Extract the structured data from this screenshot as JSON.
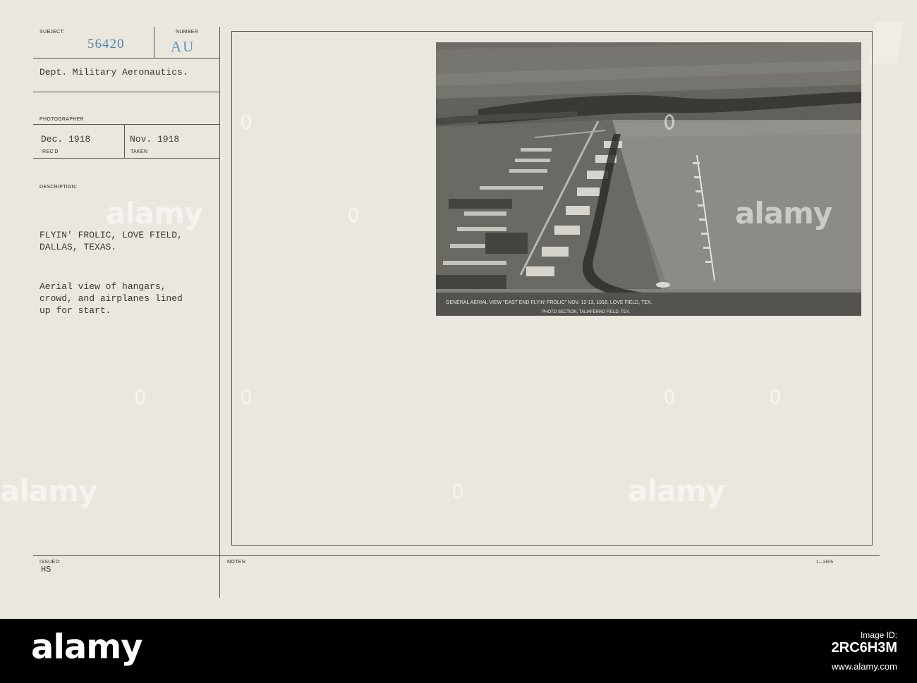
{
  "card": {
    "subject_label": "SUBJECT:",
    "subject_number": "56420",
    "number_label": "NUMBER",
    "number_value": "AU",
    "department": "Dept. Military Aeronautics.",
    "photographer_label": "PHOTOGRAPHER",
    "received_date": "Dec. 1918",
    "received_label": "REC'D",
    "taken_date": "Nov. 1918",
    "taken_label": "TAKEN",
    "description_label": "DESCRIPTION:",
    "title_line1": "FLYIN' FROLIC, LOVE FIELD,",
    "title_line2": "DALLAS, TEXAS.",
    "desc_line1": "Aerial view of hangars,",
    "desc_line2": "crowd, and airplanes lined",
    "desc_line3": "up for start.",
    "issued_label": "ISSUED:",
    "issued_value": "HS",
    "notes_label": "NOTES:",
    "form_number": "1—3605"
  },
  "photo": {
    "caption_line1": "GENERAL AERIAL VIEW \"EAST END FLYIN' FROLIC\" NOV. 12-13, 1918, LOVE FIELD, TEX.",
    "caption_line2": "PHOTO SECTION, TALIAFERRO FIELD, TEX."
  },
  "watermark": {
    "text": "alamy"
  },
  "footer": {
    "logo": "alamy",
    "image_id_label": "Image ID:",
    "image_id": "2RC6H3M",
    "site": "www.alamy.com"
  },
  "colors": {
    "card": "#ebe6de",
    "stamp_blue": "#4f8aa8",
    "footer": "#000000"
  }
}
